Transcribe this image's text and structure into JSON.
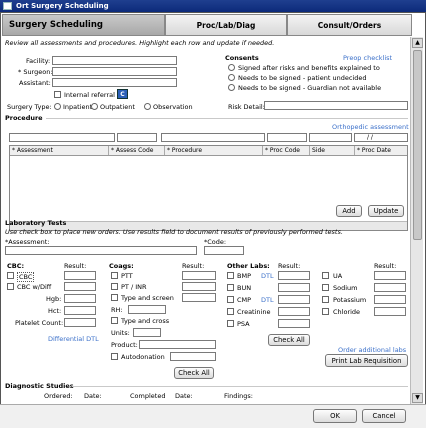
{
  "window": {
    "title": "Ort Surgery Scheduling"
  },
  "tabs": [
    "Surgery Scheduling",
    "Proc/Lab/Diag",
    "Consult/Orders"
  ],
  "intro": "Review all assessments and procedures. Highlight each row and update if needed.",
  "fields": {
    "facility": "Facility:",
    "surgeon": "* Surgeon:",
    "assistant": "Assistant:",
    "internal_referral": "Internal referral",
    "surgery_type": "Surgery Type:",
    "surgery_types": [
      "Inpatient",
      "Outpatient",
      "Observation"
    ],
    "risk_detail": "Risk Detail:"
  },
  "consents": {
    "title": "Consents",
    "link": "Preop checklist",
    "options": [
      "Signed after risks and benefits explained to",
      "Needs to be signed - patient undecided",
      "Needs to be signed - Guardian not available"
    ]
  },
  "procedure": {
    "title": "Procedure",
    "link": "Orthopedic assessment",
    "date_sep": "/ /",
    "columns": [
      "* Assessment",
      "* Assess Code",
      "* Procedure",
      "* Proc Code",
      "Side",
      "* Proc Date"
    ],
    "add": "Add",
    "update": "Update"
  },
  "labs": {
    "title": "Laboratory Tests",
    "instructions": "Use check box to place new orders. Use results field to document results of previously performed tests.",
    "assessment": "*Assessment:",
    "code": "*Code:",
    "cbc": {
      "title": "CBC:",
      "result": "Result:",
      "items": [
        "CBC",
        "CBC w/Diff"
      ],
      "values": [
        "Hgb:",
        "Hct:",
        "Platelet Count:"
      ],
      "link": "Differential DTL"
    },
    "coags": {
      "title": "Coags:",
      "result": "Result:",
      "items": [
        "PTT",
        "PT / INR",
        "Type and screen"
      ],
      "rh": "RH:",
      "cross": "Type and cross",
      "units": "Units:",
      "product": "Product:",
      "auto": "Autodonation",
      "check_all": "Check All"
    },
    "other": {
      "title": "Other Labs:",
      "result": "Result:",
      "result2": "Result:",
      "col1": [
        "BMP",
        "BUN",
        "CMP",
        "Creatinine",
        "PSA"
      ],
      "dtl": "DTL",
      "col2": [
        "UA",
        "Sodium",
        "Potassium",
        "Chloride"
      ],
      "check_all": "Check All",
      "order_link": "Order additional labs",
      "print": "Print Lab Requisition"
    }
  },
  "diagnostic": {
    "title": "Diagnostic Studies",
    "columns": [
      "Ordered:",
      "Date:",
      "Completed",
      "Date:",
      "Findings:"
    ]
  },
  "footer": {
    "ok": "OK",
    "cancel": "Cancel"
  }
}
